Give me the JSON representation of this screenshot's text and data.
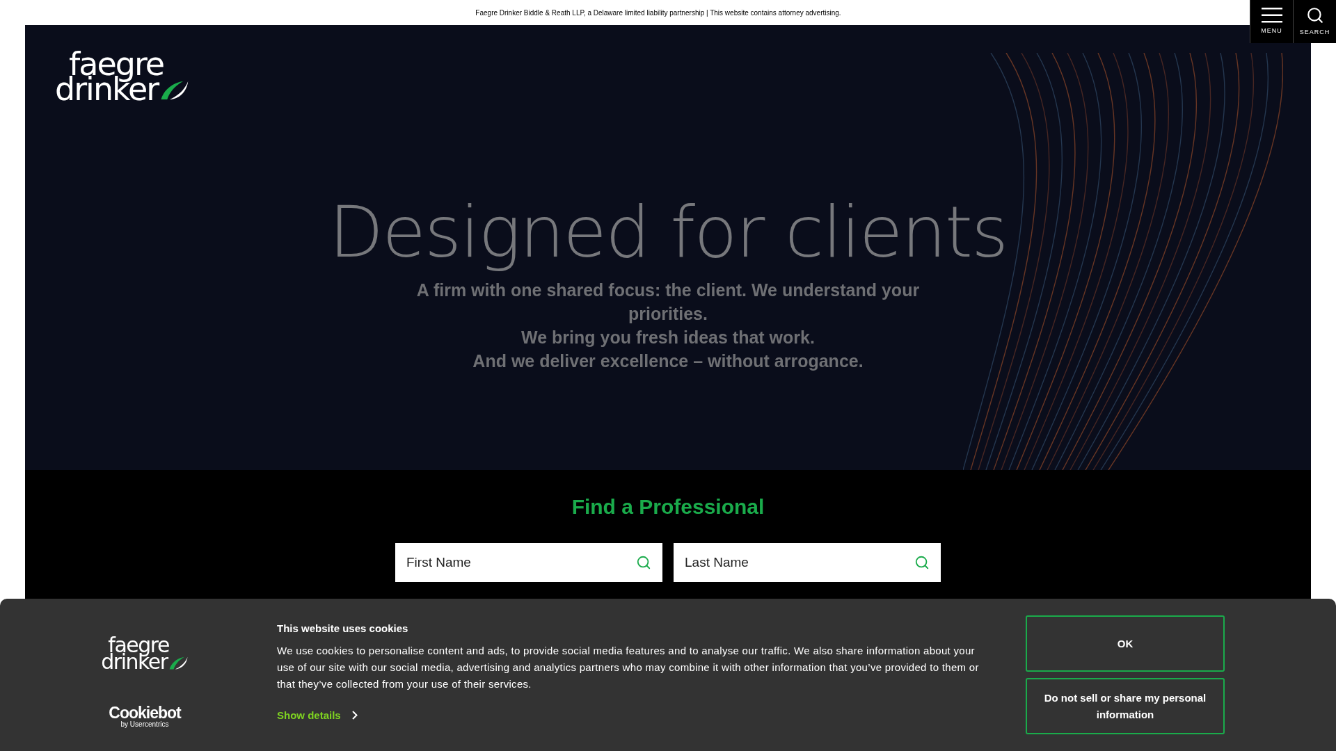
{
  "top_bar": {
    "disclaimer": "Faegre Drinker Biddle & Reath LLP, a Delaware limited liability partnership | This website contains attorney advertising."
  },
  "header_buttons": [
    {
      "label": "MENU",
      "kind": "menu"
    },
    {
      "label": "SEARCH",
      "kind": "search"
    }
  ],
  "logo": {
    "line1": "faegre",
    "line2": "drinker"
  },
  "hero": {
    "title": "Designed for clients",
    "lines": [
      "A firm with one shared focus: the client. We understand your priorities.",
      "We bring you fresh ideas that work.",
      "And we deliver excellence – without arrogance."
    ]
  },
  "find_professional": {
    "title": "Find a Professional",
    "fields": [
      {
        "placeholder": "First Name"
      },
      {
        "placeholder": "Last Name"
      }
    ]
  },
  "cookie_banner": {
    "logo": {
      "line1": "faegre",
      "line2": "drinker"
    },
    "provider_logo": {
      "name": "Cookiebot",
      "tagline": "by Usercentrics"
    },
    "title": "This website uses cookies",
    "body": "We use cookies to personalise content and ads, to provide social media features and to analyse our traffic. We also share information about your use of our site with our social media, advertising and analytics partners who may combine it with other information that you’ve provided to them or that they’ve collected from your use of their services.",
    "show_details": "Show details",
    "buttons": [
      "OK",
      "Do not sell or share my personal information"
    ]
  }
}
